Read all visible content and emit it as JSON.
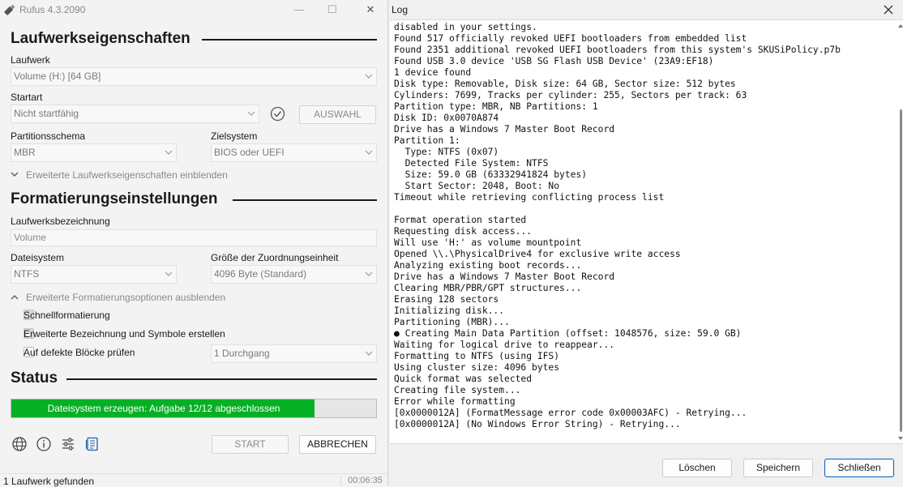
{
  "rufus": {
    "title": "Rufus 4.3.2090",
    "window_controls": {
      "minimize": "—",
      "maximize": "☐",
      "close": "✕"
    },
    "drive_properties": {
      "heading": "Laufwerkseigenschaften",
      "drive_label": "Laufwerk",
      "drive_value": "Volume (H:) [64 GB]",
      "boot_label": "Startart",
      "boot_value": "Nicht startfähig",
      "select_button": "AUSWAHL",
      "partition_label": "Partitionsschema",
      "partition_value": "MBR",
      "target_label": "Zielsystem",
      "target_value": "BIOS oder UEFI",
      "advanced_toggle": "Erweiterte Laufwerkseigenschaften einblenden"
    },
    "format_options": {
      "heading": "Formatierungseinstellungen",
      "volume_label_label": "Laufwerksbezeichnung",
      "volume_label_value": "Volume",
      "filesystem_label": "Dateisystem",
      "filesystem_value": "NTFS",
      "cluster_label": "Größe der Zuordnungseinheit",
      "cluster_value": "4096 Byte (Standard)",
      "advanced_toggle": "Erweiterte Formatierungsoptionen ausblenden",
      "quick_format": {
        "label": "Schnellformatierung",
        "checked": true
      },
      "extended_label": {
        "label": "Erweiterte Bezeichnung und Symbole erstellen",
        "checked": true
      },
      "bad_blocks": {
        "label": "Auf defekte Blöcke prüfen",
        "checked": false
      },
      "passes_value": "1 Durchgang"
    },
    "status": {
      "heading": "Status",
      "progress_text": "Dateisystem erzeugen: Aufgabe 12/12 abgeschlossen",
      "progress_fraction": 0.83
    },
    "toolbar": {
      "icons": [
        "globe-icon",
        "info-icon",
        "settings-sliders-icon",
        "log-icon"
      ],
      "start_button": "START",
      "cancel_button": "ABBRECHEN"
    },
    "statusbar": {
      "devices_found": "1 Laufwerk gefunden",
      "elapsed": "00:06:35"
    },
    "colors": {
      "progress": "#06b025",
      "heading_text": "#1a1a1a",
      "disabled_text": "#8a8a8a"
    }
  },
  "log": {
    "title": "Log",
    "lines": [
      "disabled in your settings.",
      "Found 517 officially revoked UEFI bootloaders from embedded list",
      "Found 2351 additional revoked UEFI bootloaders from this system's SKUSiPolicy.p7b",
      "Found USB 3.0 device 'USB SG Flash USB Device' (23A9:EF18)",
      "1 device found",
      "Disk type: Removable, Disk size: 64 GB, Sector size: 512 bytes",
      "Cylinders: 7699, Tracks per cylinder: 255, Sectors per track: 63",
      "Partition type: MBR, NB Partitions: 1",
      "Disk ID: 0x0070A874",
      "Drive has a Windows 7 Master Boot Record",
      "Partition 1:",
      "  Type: NTFS (0x07)",
      "  Detected File System: NTFS",
      "  Size: 59.0 GB (63332941824 bytes)",
      "  Start Sector: 2048, Boot: No",
      "Timeout while retrieving conflicting process list",
      "",
      "Format operation started",
      "Requesting disk access...",
      "Will use 'H:' as volume mountpoint",
      "Opened \\\\.\\PhysicalDrive4 for exclusive write access",
      "Analyzing existing boot records...",
      "Drive has a Windows 7 Master Boot Record",
      "Clearing MBR/PBR/GPT structures...",
      "Erasing 128 sectors",
      "Initializing disk...",
      "Partitioning (MBR)...",
      "● Creating Main Data Partition (offset: 1048576, size: 59.0 GB)",
      "Waiting for logical drive to reappear...",
      "Formatting to NTFS (using IFS)",
      "Using cluster size: 4096 bytes",
      "Quick format was selected",
      "Creating file system...",
      "Error while formatting",
      "[0x0000012A] (FormatMessage error code 0x00003AFC) - Retrying...",
      "[0x0000012A] (No Windows Error String) - Retrying..."
    ],
    "buttons": {
      "clear": "Löschen",
      "save": "Speichern",
      "close": "Schließen"
    },
    "close_icon": "close-icon"
  }
}
